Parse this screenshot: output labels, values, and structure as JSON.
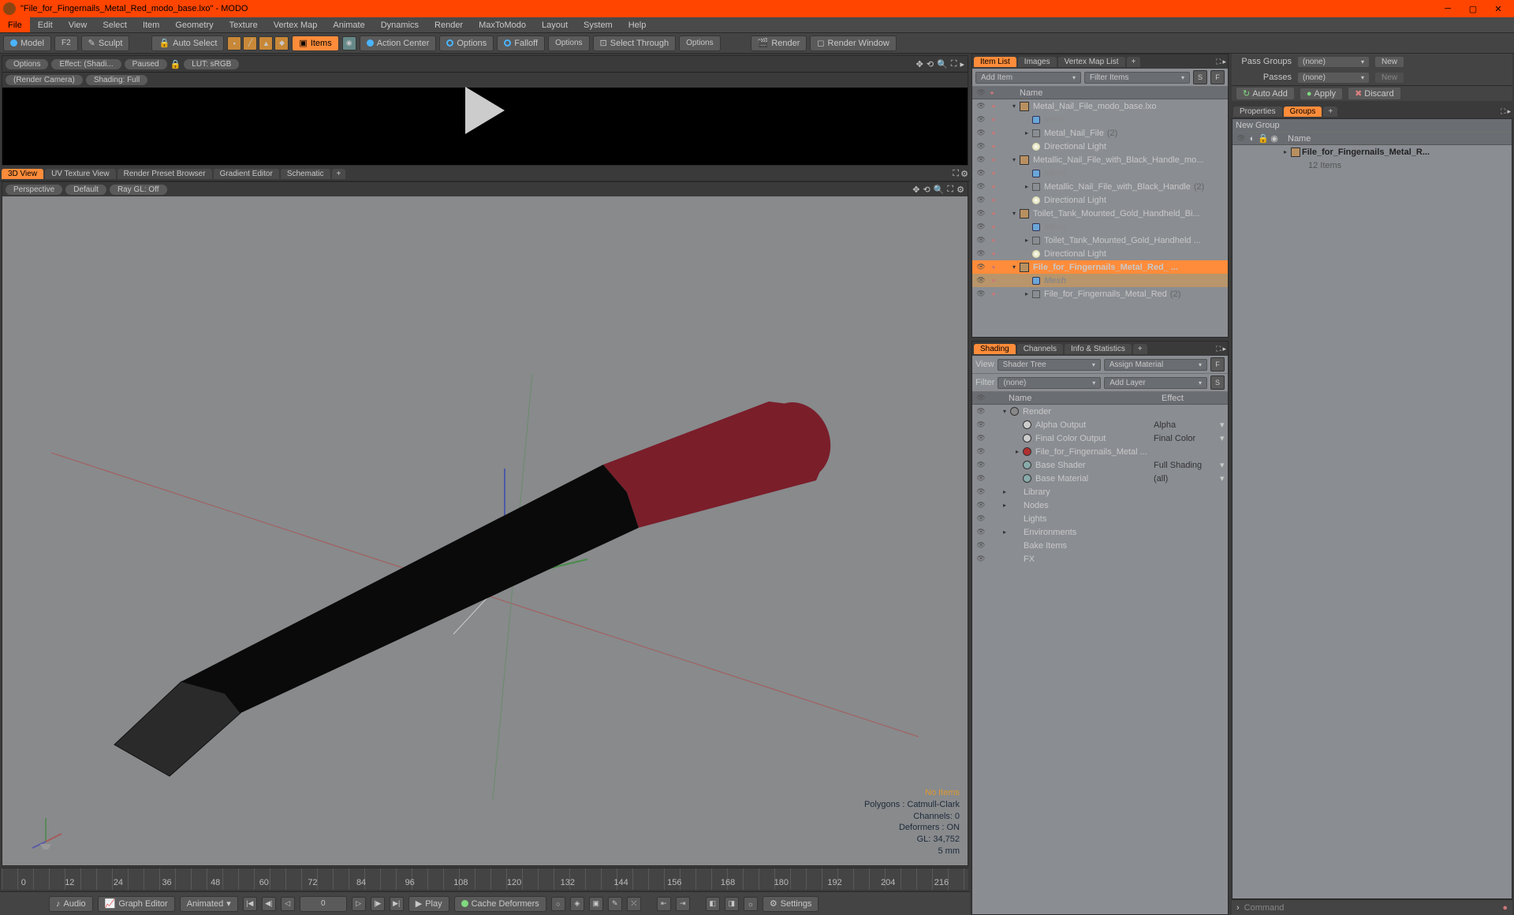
{
  "window": {
    "title": "\"File_for_Fingernails_Metal_Red_modo_base.lxo\" - MODO"
  },
  "menu": [
    "File",
    "Edit",
    "View",
    "Select",
    "Item",
    "Geometry",
    "Texture",
    "Vertex Map",
    "Animate",
    "Dynamics",
    "Render",
    "MaxToModo",
    "Layout",
    "System",
    "Help"
  ],
  "toolbar": {
    "model": "Model",
    "f2": "F2",
    "sculpt": "Sculpt",
    "auto_select": "Auto Select",
    "items": "Items",
    "action_center": "Action Center",
    "options1": "Options",
    "falloff": "Falloff",
    "options2": "Options",
    "select_through": "Select Through",
    "options3": "Options",
    "render": "Render",
    "render_window": "Render Window"
  },
  "preview": {
    "options": "Options",
    "effect": "Effect: (Shadi...",
    "paused": "Paused",
    "lut": "LUT: sRGB",
    "camera": "(Render Camera)",
    "shading": "Shading: Full"
  },
  "view_tabs": [
    "3D View",
    "UV Texture View",
    "Render Preset Browser",
    "Gradient Editor",
    "Schematic"
  ],
  "vp_bar": {
    "perspective": "Perspective",
    "default": "Default",
    "raygl": "Ray GL: Off"
  },
  "vp_stats": {
    "line1": "No Items",
    "line2": "Polygons : Catmull-Clark",
    "line3": "Channels: 0",
    "line4": "Deformers : ON",
    "line5": "GL: 34,752",
    "line6": "5 mm"
  },
  "timeline_ticks": [
    "0",
    "12",
    "24",
    "36",
    "48",
    "60",
    "72",
    "84",
    "96",
    "108",
    "120",
    "132",
    "144",
    "156",
    "168",
    "180",
    "192",
    "204",
    "216"
  ],
  "bottombar": {
    "audio": "Audio",
    "graph": "Graph Editor",
    "animated": "Animated",
    "cur": "0",
    "play": "Play",
    "cache": "Cache Deformers",
    "settings": "Settings"
  },
  "item_list": {
    "tabs": [
      "Item List",
      "Images",
      "Vertex Map List"
    ],
    "add": "Add Item",
    "filter": "Filter Items",
    "col": "Name",
    "tree": [
      {
        "d": 0,
        "a": "▾",
        "i": "box",
        "t": "Metal_Nail_File_modo_base.lxo"
      },
      {
        "d": 1,
        "a": "",
        "i": "mesh",
        "t": "Mesh",
        "dim": true
      },
      {
        "d": 1,
        "a": "▸",
        "i": "loc",
        "t": "Metal_Nail_File",
        "suf": "(2)"
      },
      {
        "d": 1,
        "a": "",
        "i": "light",
        "t": "Directional Light"
      },
      {
        "d": 0,
        "a": "▾",
        "i": "box",
        "t": "Metallic_Nail_File_with_Black_Handle_mo..."
      },
      {
        "d": 1,
        "a": "",
        "i": "mesh",
        "t": "Mesh",
        "dim": true
      },
      {
        "d": 1,
        "a": "▸",
        "i": "loc",
        "t": "Metallic_Nail_File_with_Black_Handle",
        "suf": "(2)"
      },
      {
        "d": 1,
        "a": "",
        "i": "light",
        "t": "Directional Light"
      },
      {
        "d": 0,
        "a": "▾",
        "i": "box",
        "t": "Toilet_Tank_Mounted_Gold_Handheld_Bi..."
      },
      {
        "d": 1,
        "a": "",
        "i": "mesh",
        "t": "Mesh",
        "dim": true
      },
      {
        "d": 1,
        "a": "▸",
        "i": "loc",
        "t": "Toilet_Tank_Mounted_Gold_Handheld ..."
      },
      {
        "d": 1,
        "a": "",
        "i": "light",
        "t": "Directional Light"
      },
      {
        "d": 0,
        "a": "▾",
        "i": "box",
        "t": "File_for_Fingernails_Metal_Red_  ...",
        "sel": true
      },
      {
        "d": 1,
        "a": "",
        "i": "mesh",
        "t": "Mesh",
        "dim": true,
        "sel2": true
      },
      {
        "d": 1,
        "a": "▸",
        "i": "loc",
        "t": "File_for_Fingernails_Metal_Red",
        "suf": "(2)"
      }
    ]
  },
  "shading": {
    "tabs": [
      "Shading",
      "Channels",
      "Info & Statistics"
    ],
    "view": "View",
    "shader_tree": "Shader Tree",
    "assign": "Assign Material",
    "filter": "Filter",
    "none": "(none)",
    "add_layer": "Add Layer",
    "hname": "Name",
    "heffect": "Effect",
    "tree": [
      {
        "d": 0,
        "a": "▾",
        "t": "Render",
        "e": "",
        "ball": "#888"
      },
      {
        "d": 1,
        "a": "",
        "t": "Alpha Output",
        "e": "Alpha",
        "ball": "#ccc"
      },
      {
        "d": 1,
        "a": "",
        "t": "Final Color Output",
        "e": "Final Color",
        "ball": "#ccc"
      },
      {
        "d": 1,
        "a": "▸",
        "t": "File_for_Fingernails_Metal ...",
        "e": "",
        "ball": "#b03030"
      },
      {
        "d": 1,
        "a": "",
        "t": "Base Shader",
        "e": "Full Shading",
        "ball": "#8aa"
      },
      {
        "d": 1,
        "a": "",
        "t": "Base Material",
        "e": "(all)",
        "ball": "#8aa"
      },
      {
        "d": 0,
        "a": "▸",
        "t": "Library",
        "e": ""
      },
      {
        "d": 0,
        "a": "▸",
        "t": "Nodes",
        "e": ""
      },
      {
        "d": 0,
        "a": "",
        "t": "Lights",
        "e": ""
      },
      {
        "d": 0,
        "a": "▸",
        "t": "Environments",
        "e": ""
      },
      {
        "d": 0,
        "a": "",
        "t": "Bake Items",
        "e": ""
      },
      {
        "d": 0,
        "a": "",
        "t": "FX",
        "e": ""
      }
    ]
  },
  "passes": {
    "lbl1": "Pass Groups",
    "v1": "(none)",
    "new": "New",
    "lbl2": "Passes",
    "v2": "(none)"
  },
  "actions": {
    "auto_add": "Auto Add",
    "apply": "Apply",
    "discard": "Discard"
  },
  "props_tabs": [
    "Properties",
    "Groups"
  ],
  "new_group": "New Group",
  "groups": {
    "col": "Name",
    "row": "File_for_Fingernails_Metal_R...",
    "count": "12 Items"
  },
  "command": {
    "label": "Command"
  }
}
